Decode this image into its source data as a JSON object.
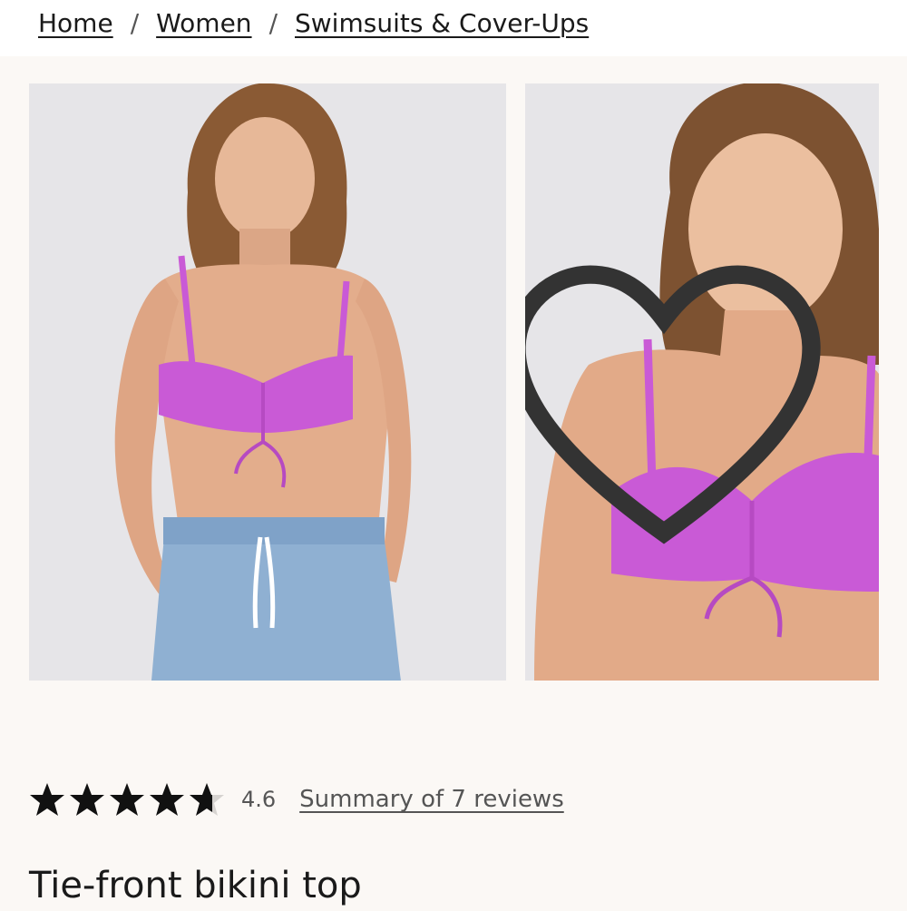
{
  "breadcrumb": {
    "items": [
      {
        "label": "Home"
      },
      {
        "label": "Women"
      },
      {
        "label": "Swimsuits & Cover-Ups"
      }
    ],
    "separator": "/"
  },
  "gallery": {
    "images": [
      {
        "description_icon": "product-photo",
        "alt": ""
      },
      {
        "description_icon": "product-photo",
        "alt": ""
      }
    ],
    "favorite_icon": "heart-icon"
  },
  "rating": {
    "value": "4.6",
    "stars_filled": 4.6,
    "stars_total": 5,
    "reviews_link": "Summary of 7 reviews"
  },
  "product": {
    "title": "Tie-front bikini top"
  },
  "colors": {
    "accent_swimsuit": "#c95ad6",
    "page_background": "#fbf8f5",
    "star": "#111111"
  }
}
